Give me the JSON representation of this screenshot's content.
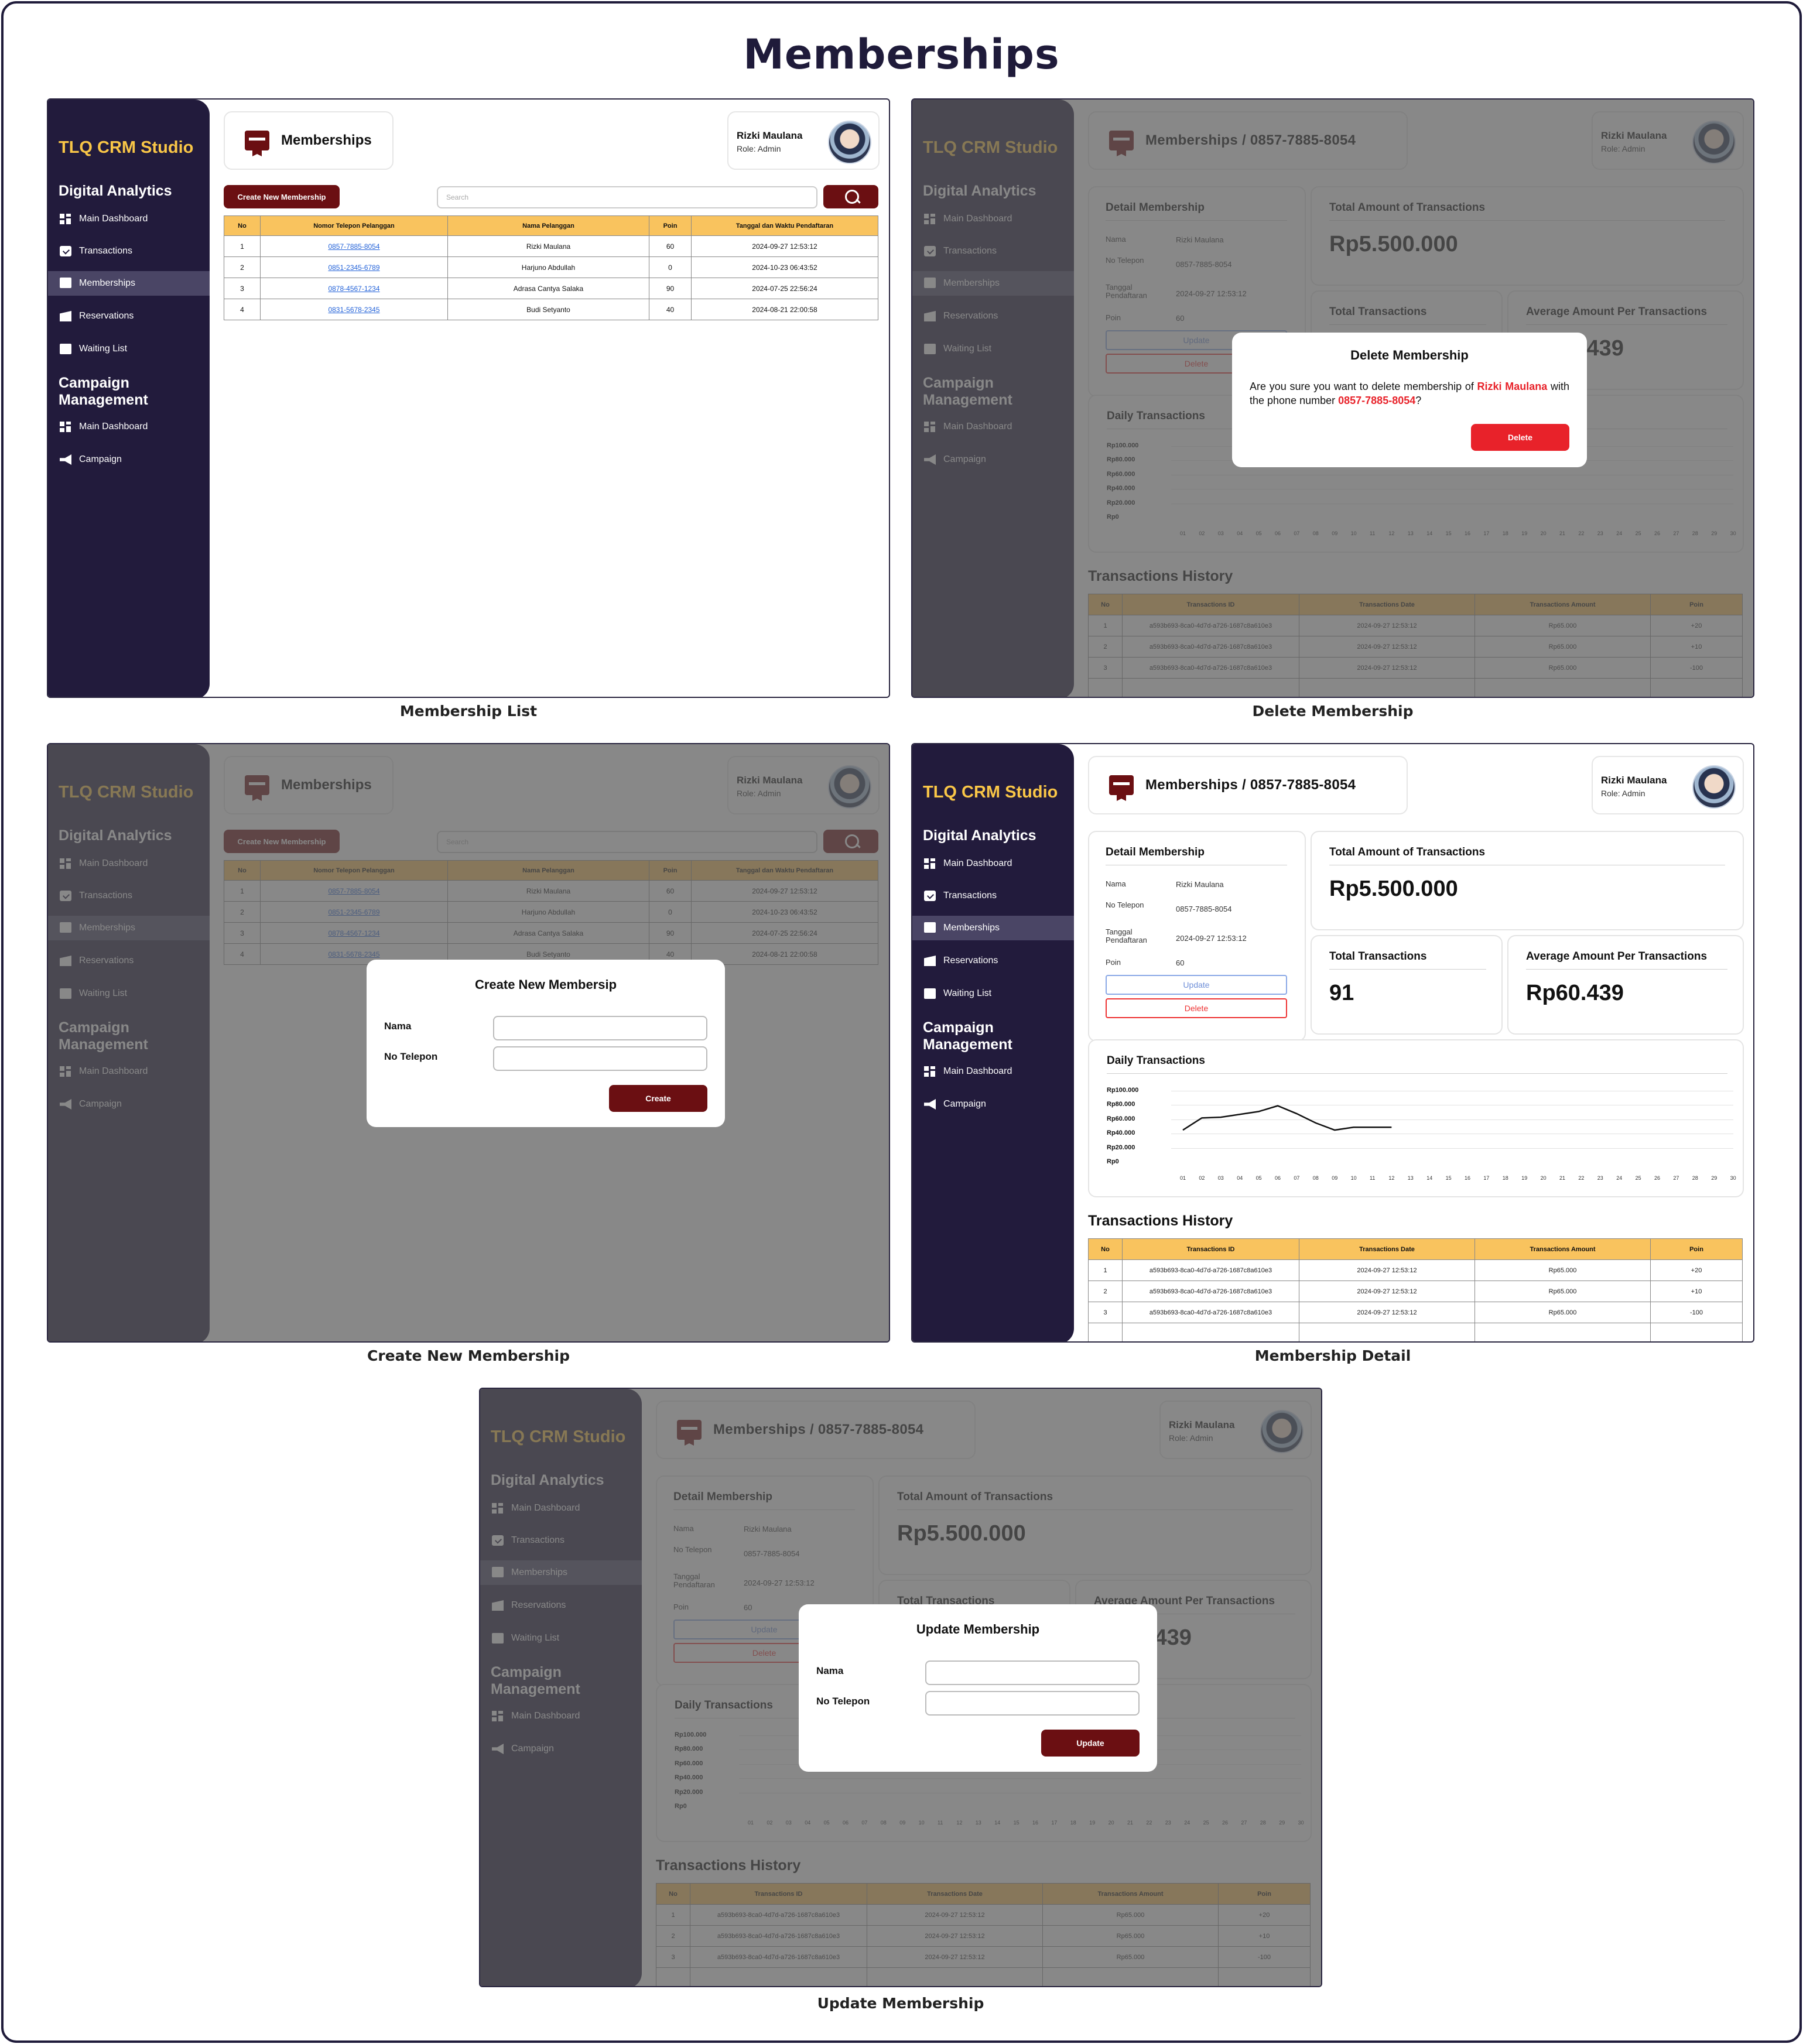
{
  "board_title": "Memberships",
  "app": {
    "brand": "TLQ CRM Studio",
    "section_digital": "Digital Analytics",
    "section_campaign": "Campaign Management",
    "nav_digital": [
      {
        "label": "Main Dashboard",
        "icon": "dashboard-icon"
      },
      {
        "label": "Transactions",
        "icon": "transactions-icon"
      },
      {
        "label": "Memberships",
        "icon": "memberships-icon"
      },
      {
        "label": "Reservations",
        "icon": "reservations-icon"
      },
      {
        "label": "Waiting List",
        "icon": "waiting-list-icon"
      }
    ],
    "nav_campaign": [
      {
        "label": "Main Dashboard",
        "icon": "dashboard-icon"
      },
      {
        "label": "Campaign",
        "icon": "campaign-icon"
      }
    ],
    "page_title": "Memberships",
    "detail_title": "Memberships   /   0857-7885-8054",
    "user_name": "Rizki Maulana",
    "user_role": "Role: Admin",
    "colors": {
      "sidebar": "#221b3c",
      "brand": "#f9c647",
      "primary": "#6b0f12",
      "table_header": "#f9c35e",
      "danger": "#e8222a",
      "link": "#2463d9"
    }
  },
  "list": {
    "create_button": "Create New Membership",
    "search_placeholder": "Search",
    "columns": [
      "No",
      "Nomor Telepon Pelanggan",
      "Nama Pelanggan",
      "Poin",
      "Tanggal dan Waktu Pendaftaran"
    ],
    "rows": [
      {
        "no": "1",
        "phone": "0857-7885-8054",
        "name": "Rizki Maulana",
        "poin": "60",
        "date": "2024-09-27 12:53:12"
      },
      {
        "no": "2",
        "phone": "0851-2345-6789",
        "name": "Harjuno Abdullah",
        "poin": "0",
        "date": "2024-10-23 06:43:52"
      },
      {
        "no": "3",
        "phone": "0878-4567-1234",
        "name": "Adrasa Cantya Salaka",
        "poin": "90",
        "date": "2024-07-25 22:56:24"
      },
      {
        "no": "4",
        "phone": "0831-5678-2345",
        "name": "Budi Setyanto",
        "poin": "40",
        "date": "2024-08-21 22:00:58"
      }
    ]
  },
  "detail": {
    "card_title": "Detail Membership",
    "fields": [
      {
        "key": "Nama",
        "value": "Rizki Maulana"
      },
      {
        "key": "No Telepon",
        "value": "0857-7885-8054"
      },
      {
        "key": "Tanggal Pendaftaran",
        "value": "2024-09-27 12:53:12"
      },
      {
        "key": "Poin",
        "value": "60"
      }
    ],
    "update_button": "Update",
    "delete_button": "Delete",
    "total_amount_title": "Total Amount of Transactions",
    "total_amount_value": "Rp5.500.000",
    "total_trx_title": "Total Transactions",
    "total_trx_value": "91",
    "avg_title": "Average Amount Per Transactions",
    "avg_value": "Rp60.439",
    "daily_title": "Daily Transactions",
    "history_title": "Transactions History",
    "history_columns": [
      "No",
      "Transactions ID",
      "Transactions Date",
      "Transactions Amount",
      "Poin"
    ],
    "history_rows": [
      {
        "no": "1",
        "id": "a593b693-8ca0-4d7d-a726-1687c8a610e3",
        "date": "2024-09-27 12:53:12",
        "amount": "Rp65.000",
        "poin": "+20"
      },
      {
        "no": "2",
        "id": "a593b693-8ca0-4d7d-a726-1687c8a610e3",
        "date": "2024-09-27 12:53:12",
        "amount": "Rp65.000",
        "poin": "+10"
      },
      {
        "no": "3",
        "id": "a593b693-8ca0-4d7d-a726-1687c8a610e3",
        "date": "2024-09-27 12:53:12",
        "amount": "Rp65.000",
        "poin": "-100"
      }
    ]
  },
  "chart_data": {
    "type": "line",
    "title": "Daily Transactions",
    "y_ticks": [
      "Rp100.000",
      "Rp80.000",
      "Rp60.000",
      "Rp40.000",
      "Rp20.000",
      "Rp0"
    ],
    "ylim": [
      0,
      100000
    ],
    "x": [
      "01",
      "02",
      "03",
      "04",
      "05",
      "06",
      "07",
      "08",
      "09",
      "10",
      "11",
      "12",
      "13",
      "14",
      "15",
      "16",
      "17",
      "18",
      "19",
      "20",
      "21",
      "22",
      "23",
      "24",
      "25",
      "26",
      "27",
      "28",
      "29",
      "30"
    ],
    "series": [
      {
        "values": [
          45000,
          62000,
          63000,
          67000,
          71000,
          79000,
          68000,
          55000,
          45000,
          49000,
          49000,
          49000
        ]
      }
    ],
    "grid": true
  },
  "modals": {
    "delete": {
      "title": "Delete Membership",
      "text_a": "Are you sure you want to delete membership of ",
      "name": "Rizki Maulana",
      "text_b": " with the phone number ",
      "phone": "0857-7885-8054",
      "text_c": "?",
      "button": "Delete"
    },
    "create": {
      "title": "Create New Membersip",
      "label_nama": "Nama",
      "label_phone": "No Telepon",
      "button": "Create"
    },
    "update": {
      "title": "Update Membership",
      "label_nama": "Nama",
      "label_phone": "No Telepon",
      "button": "Update"
    }
  },
  "captions": {
    "list": "Membership List",
    "delete": "Delete Membership",
    "create": "Create New Membership",
    "detail": "Membership Detail",
    "update": "Update Membership"
  }
}
